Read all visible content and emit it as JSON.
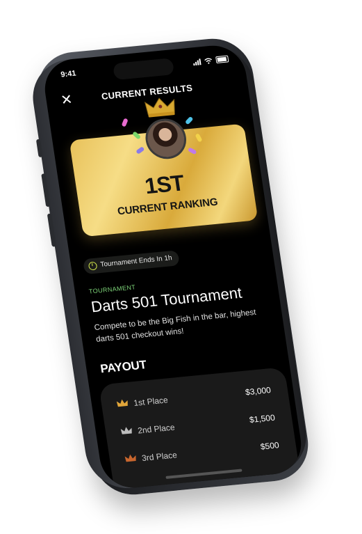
{
  "status": {
    "time": "9:41"
  },
  "header": {
    "title": "CURRENT RESULTS"
  },
  "ranking": {
    "value": "1ST",
    "label": "CURRENT RANKING"
  },
  "tournament_timer": "Tournament Ends In 1h",
  "section_tag": "TOURNAMENT",
  "tournament_title": "Darts 501 Tournament",
  "description": "Compete to be the Big Fish in the bar, highest darts 501 checkout wins!",
  "payout": {
    "title": "PAYOUT",
    "rows": [
      {
        "label": "1st Place",
        "amount": "$3,000",
        "icon": "gold-crown-icon",
        "color": "#e0a53a"
      },
      {
        "label": "2nd Place",
        "amount": "$1,500",
        "icon": "silver-crown-icon",
        "color": "#bdbdbd"
      },
      {
        "label": "3rd Place",
        "amount": "$500",
        "icon": "bronze-crown-icon",
        "color": "#c8662e"
      }
    ]
  },
  "colors": {
    "gold": "#e8c15a",
    "accent_green": "#7fd67a",
    "background": "#000000"
  }
}
